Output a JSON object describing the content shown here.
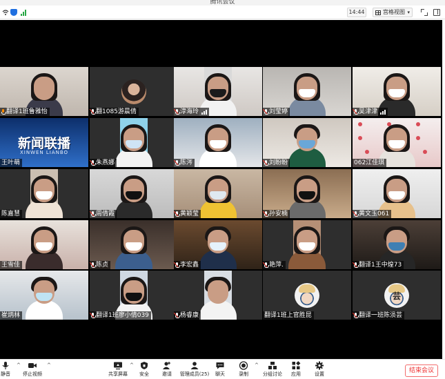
{
  "window": {
    "title": "腾讯会议"
  },
  "header": {
    "time": "14:44",
    "view_label": "宫格视图"
  },
  "tiles": [
    {
      "name": "翻译1班鲁雅怡",
      "mic": "active",
      "bars": false
    },
    {
      "name": "翻1085游晨倩",
      "mic": "off",
      "bars": false
    },
    {
      "name": "淳海玲",
      "mic": "off",
      "bars": true
    },
    {
      "name": "刘莹婷",
      "mic": "off",
      "bars": false
    },
    {
      "name": "吴津津",
      "mic": "off",
      "bars": true
    },
    {
      "name": "王叶萌",
      "mic": "none",
      "bars": false
    },
    {
      "name": "朱燕娜",
      "mic": "off",
      "bars": false
    },
    {
      "name": "陈涔",
      "mic": "off",
      "bars": false
    },
    {
      "name": "刘盼盼",
      "mic": "off",
      "bars": false
    },
    {
      "name": "062江佳琪",
      "mic": "none",
      "bars": false
    },
    {
      "name": "陈嘉慧",
      "mic": "none",
      "bars": false
    },
    {
      "name": "周倩霞",
      "mic": "off",
      "bars": false
    },
    {
      "name": "黄颖莹",
      "mic": "off",
      "bars": false
    },
    {
      "name": "孙安楠",
      "mic": "off",
      "bars": false
    },
    {
      "name": "黄文玉061",
      "mic": "off",
      "bars": false
    },
    {
      "name": "王雪佳",
      "mic": "none",
      "bars": false
    },
    {
      "name": "陈贞",
      "mic": "off",
      "bars": false
    },
    {
      "name": "李宏鑫",
      "mic": "off",
      "bars": false
    },
    {
      "name": "艳萍.",
      "mic": "off",
      "bars": false
    },
    {
      "name": "翻译1王中煌73",
      "mic": "off",
      "bars": false
    },
    {
      "name": "崔炳林",
      "mic": "none",
      "bars": false
    },
    {
      "name": "翻译1班廖小倩039",
      "mic": "off",
      "bars": false
    },
    {
      "name": "杨睿康",
      "mic": "off",
      "bars": false
    },
    {
      "name": "翻译1班上官胜昆",
      "mic": "none",
      "bars": false
    },
    {
      "name": "翻译一班陈涢芸",
      "mic": "off",
      "bars": false
    }
  ],
  "banner": {
    "text": "新闻联播",
    "sub": "XINWEN LIANBO"
  },
  "avatar_text": "芸",
  "toolbar": {
    "mute": "静音",
    "stop_video": "停止视频",
    "share": "共享屏幕",
    "security": "安全",
    "invite": "邀请",
    "members": "管理成员(25)",
    "chat": "聊天",
    "record": "录制",
    "breakout": "分组讨论",
    "apps": "应用",
    "settings": "设置",
    "end": "结束会议"
  },
  "colors": {
    "end_button": "#e33333",
    "active_mic": "#ff8a00",
    "shield": "#1f6fe0",
    "signal": "#27a745"
  }
}
